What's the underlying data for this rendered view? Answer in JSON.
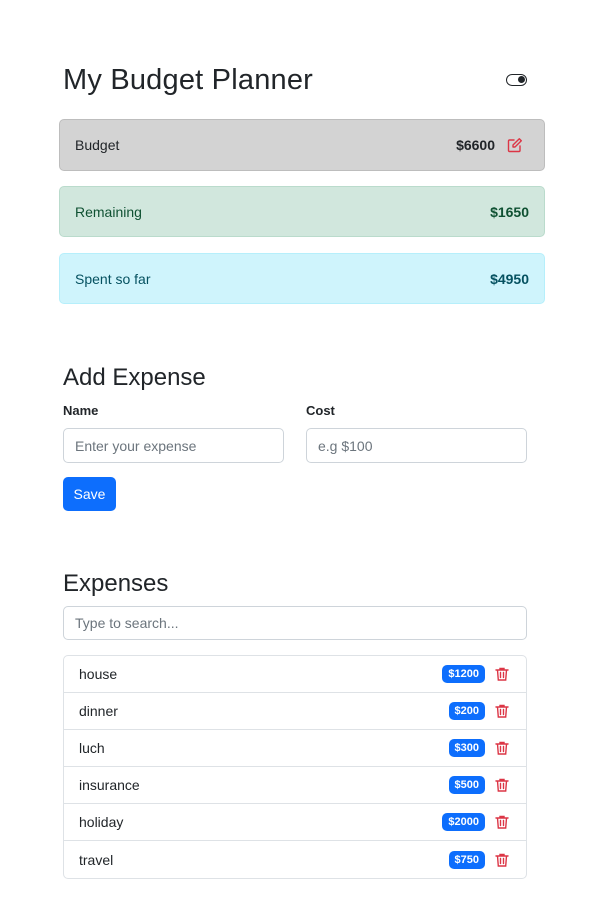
{
  "header": {
    "title": "My Budget Planner",
    "theme_toggle_icon": "toggle-switch-icon"
  },
  "summary": {
    "budget": {
      "label": "Budget",
      "amount": "$6600",
      "edit_icon": "edit-icon"
    },
    "remaining": {
      "label": "Remaining",
      "amount": "$1650"
    },
    "spent": {
      "label": "Spent so far",
      "amount": "$4950"
    }
  },
  "add_expense": {
    "title": "Add Expense",
    "name_label": "Name",
    "name_placeholder": "Enter your expense",
    "cost_label": "Cost",
    "cost_placeholder": "e.g $100",
    "save_label": "Save"
  },
  "expenses": {
    "title": "Expenses",
    "search_placeholder": "Type to search...",
    "items": [
      {
        "name": "house",
        "cost": "$1200"
      },
      {
        "name": "dinner",
        "cost": "$200"
      },
      {
        "name": "luch",
        "cost": "$300"
      },
      {
        "name": "insurance",
        "cost": "$500"
      },
      {
        "name": "holiday",
        "cost": "$2000"
      },
      {
        "name": "travel",
        "cost": "$750"
      }
    ]
  },
  "colors": {
    "primary": "#0d6efd",
    "danger": "#dc3545",
    "success_bg": "#d1e7dd",
    "info_bg": "#cff4fc",
    "secondary_bg": "#d3d3d3"
  }
}
